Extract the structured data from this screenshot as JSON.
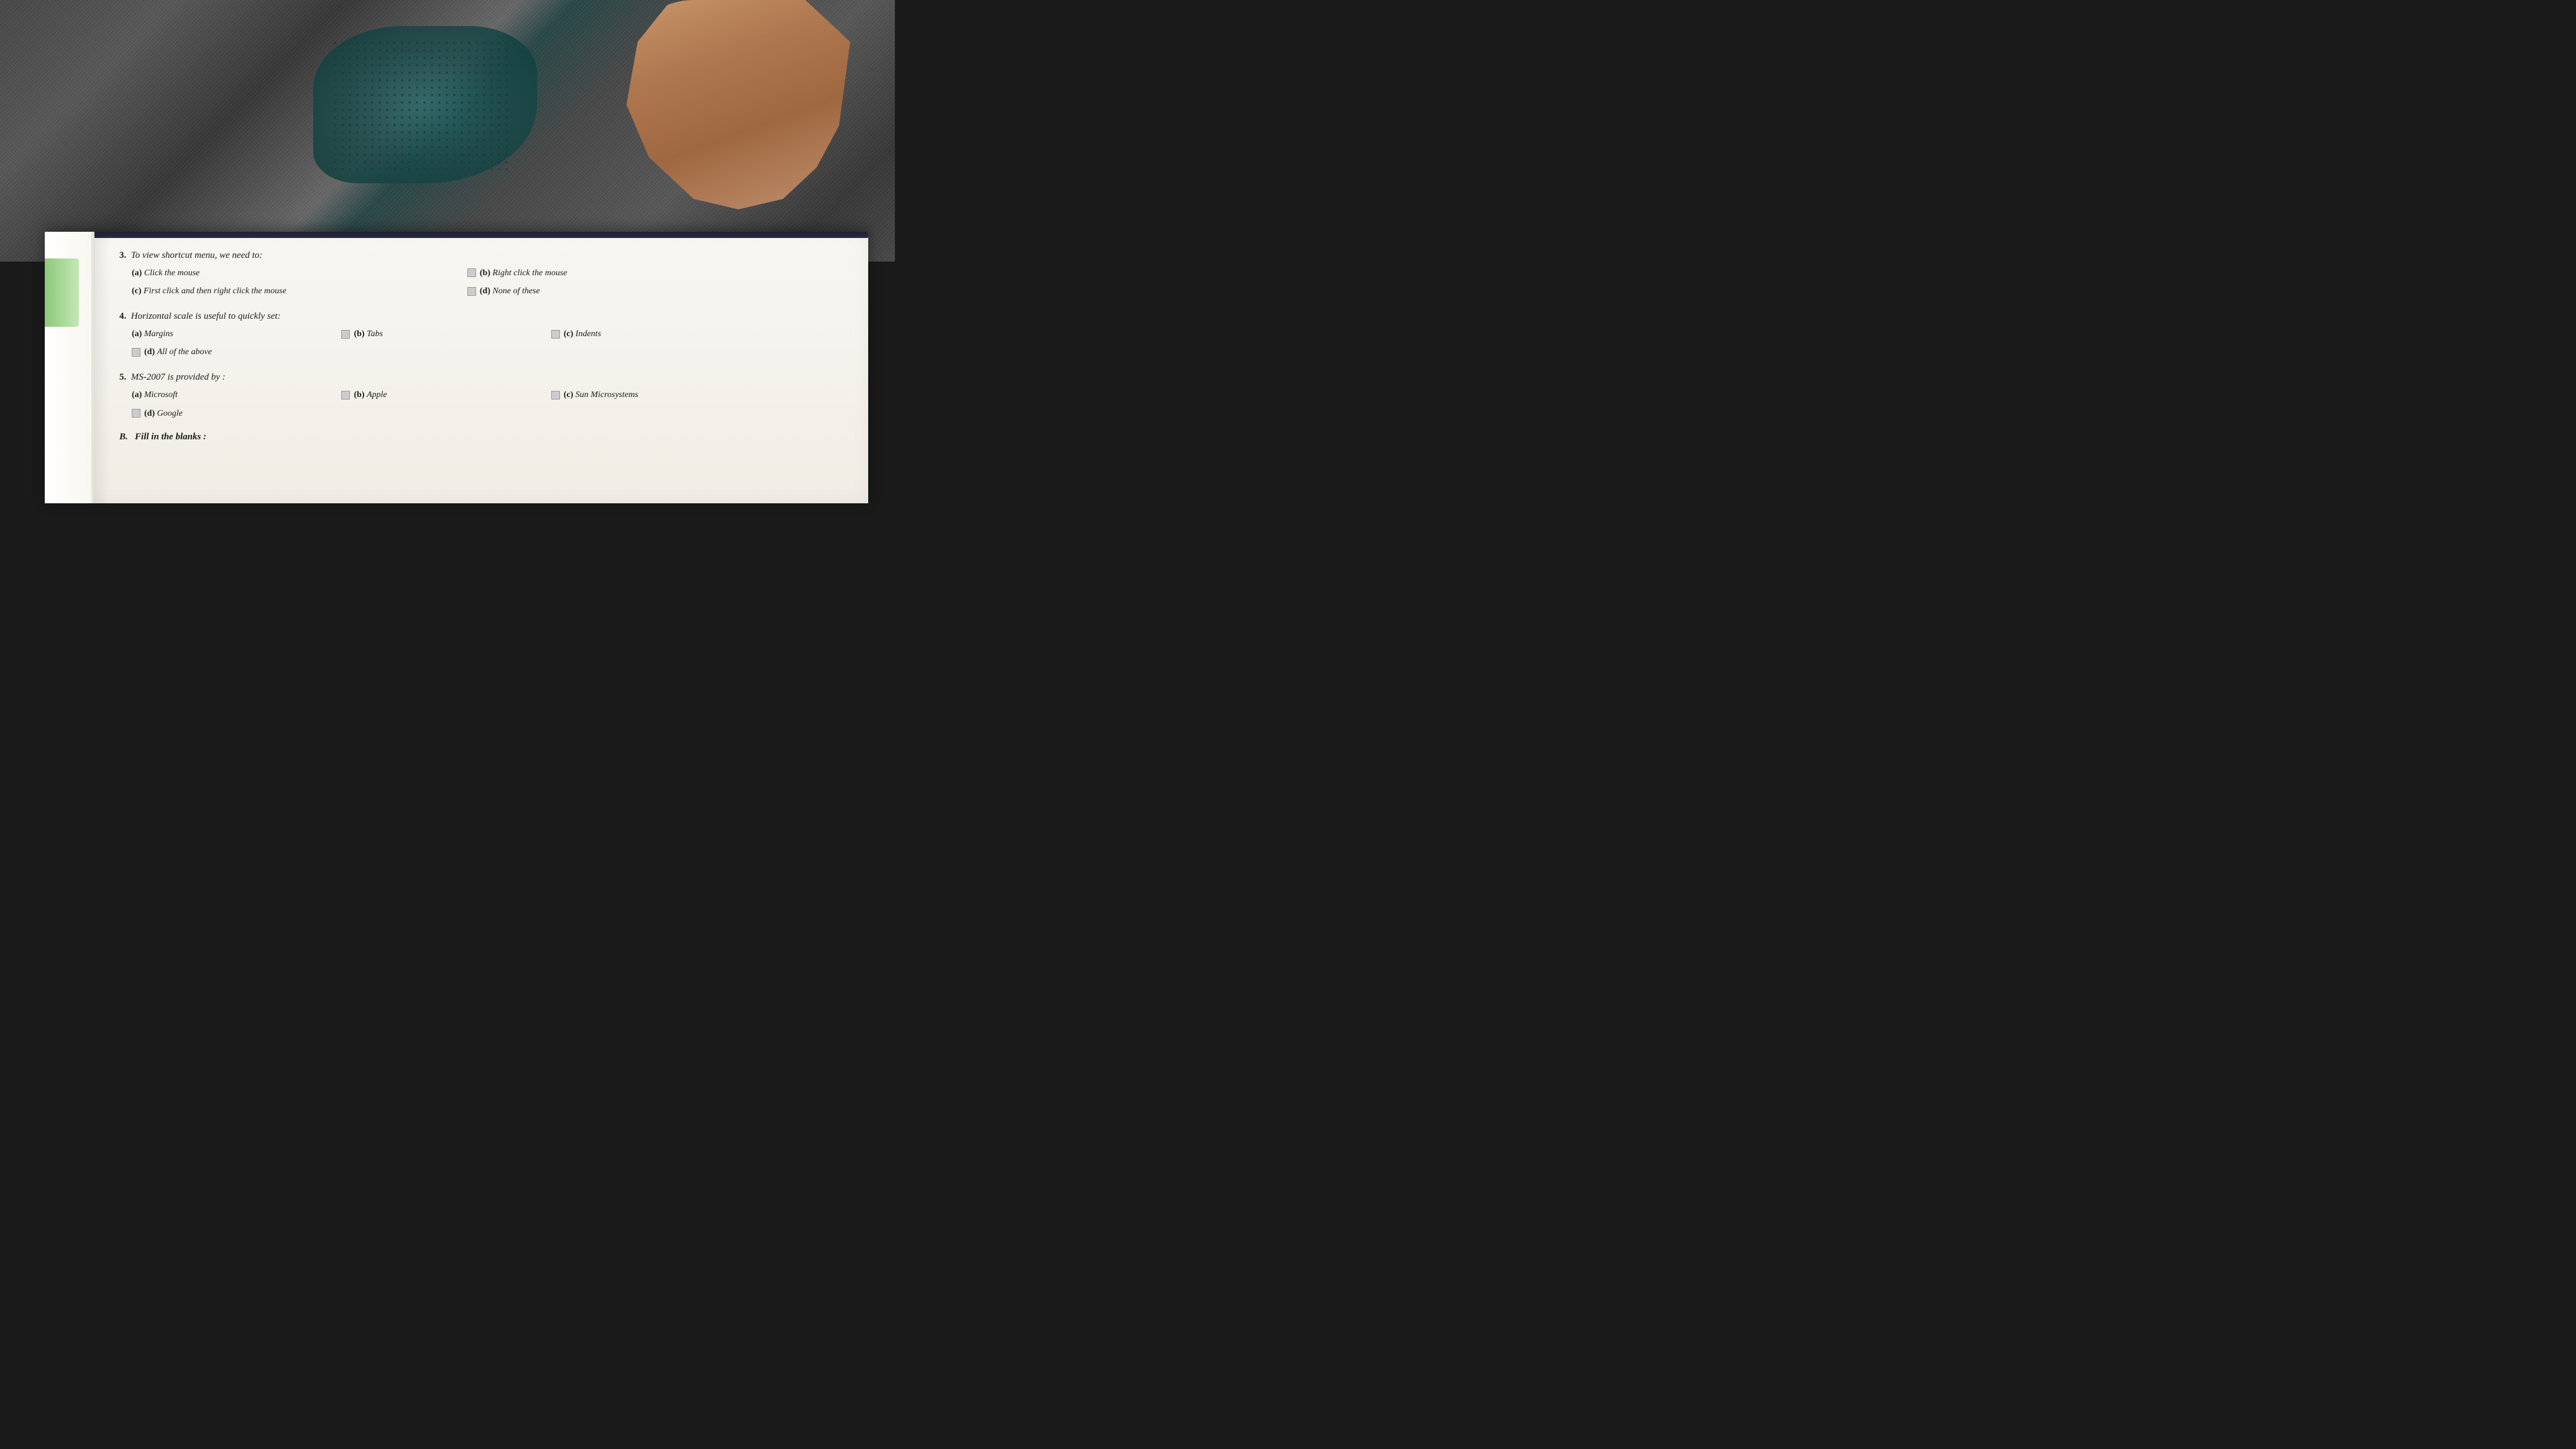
{
  "background": {
    "description": "Fabric cloth texture with hand holding book"
  },
  "book": {
    "questions": [
      {
        "number": "3.",
        "text": "To view shortcut menu, we need to:",
        "options": [
          {
            "key": "(a)",
            "text": "Click the mouse",
            "checkbox": true
          },
          {
            "key": "(b)",
            "text": "Right click the mouse",
            "checkbox": true
          },
          {
            "key": "(c)",
            "text": "First click and then right click the mouse",
            "checkbox": true
          },
          {
            "key": "(d)",
            "text": "None of these",
            "checkbox": true
          }
        ]
      },
      {
        "number": "4.",
        "text": "Horizontal scale is useful to quickly set:",
        "options": [
          {
            "key": "(a)",
            "text": "Margins",
            "checkbox": true
          },
          {
            "key": "(b)",
            "text": "Tabs",
            "checkbox": true
          },
          {
            "key": "(c)",
            "text": "Indents",
            "checkbox": true
          },
          {
            "key": "(d)",
            "text": "All of the above",
            "checkbox": true
          }
        ]
      },
      {
        "number": "5.",
        "text": "MS-2007 is provided by :",
        "options": [
          {
            "key": "(a)",
            "text": "Microsoft",
            "checkbox": true
          },
          {
            "key": "(b)",
            "text": "Apple",
            "checkbox": true
          },
          {
            "key": "(c)",
            "text": "Sun Microsystems",
            "checkbox": true
          },
          {
            "key": "(d)",
            "text": "Google",
            "checkbox": true
          }
        ]
      }
    ],
    "section_b": {
      "label": "B.",
      "title": "Fill in the blanks :"
    }
  }
}
